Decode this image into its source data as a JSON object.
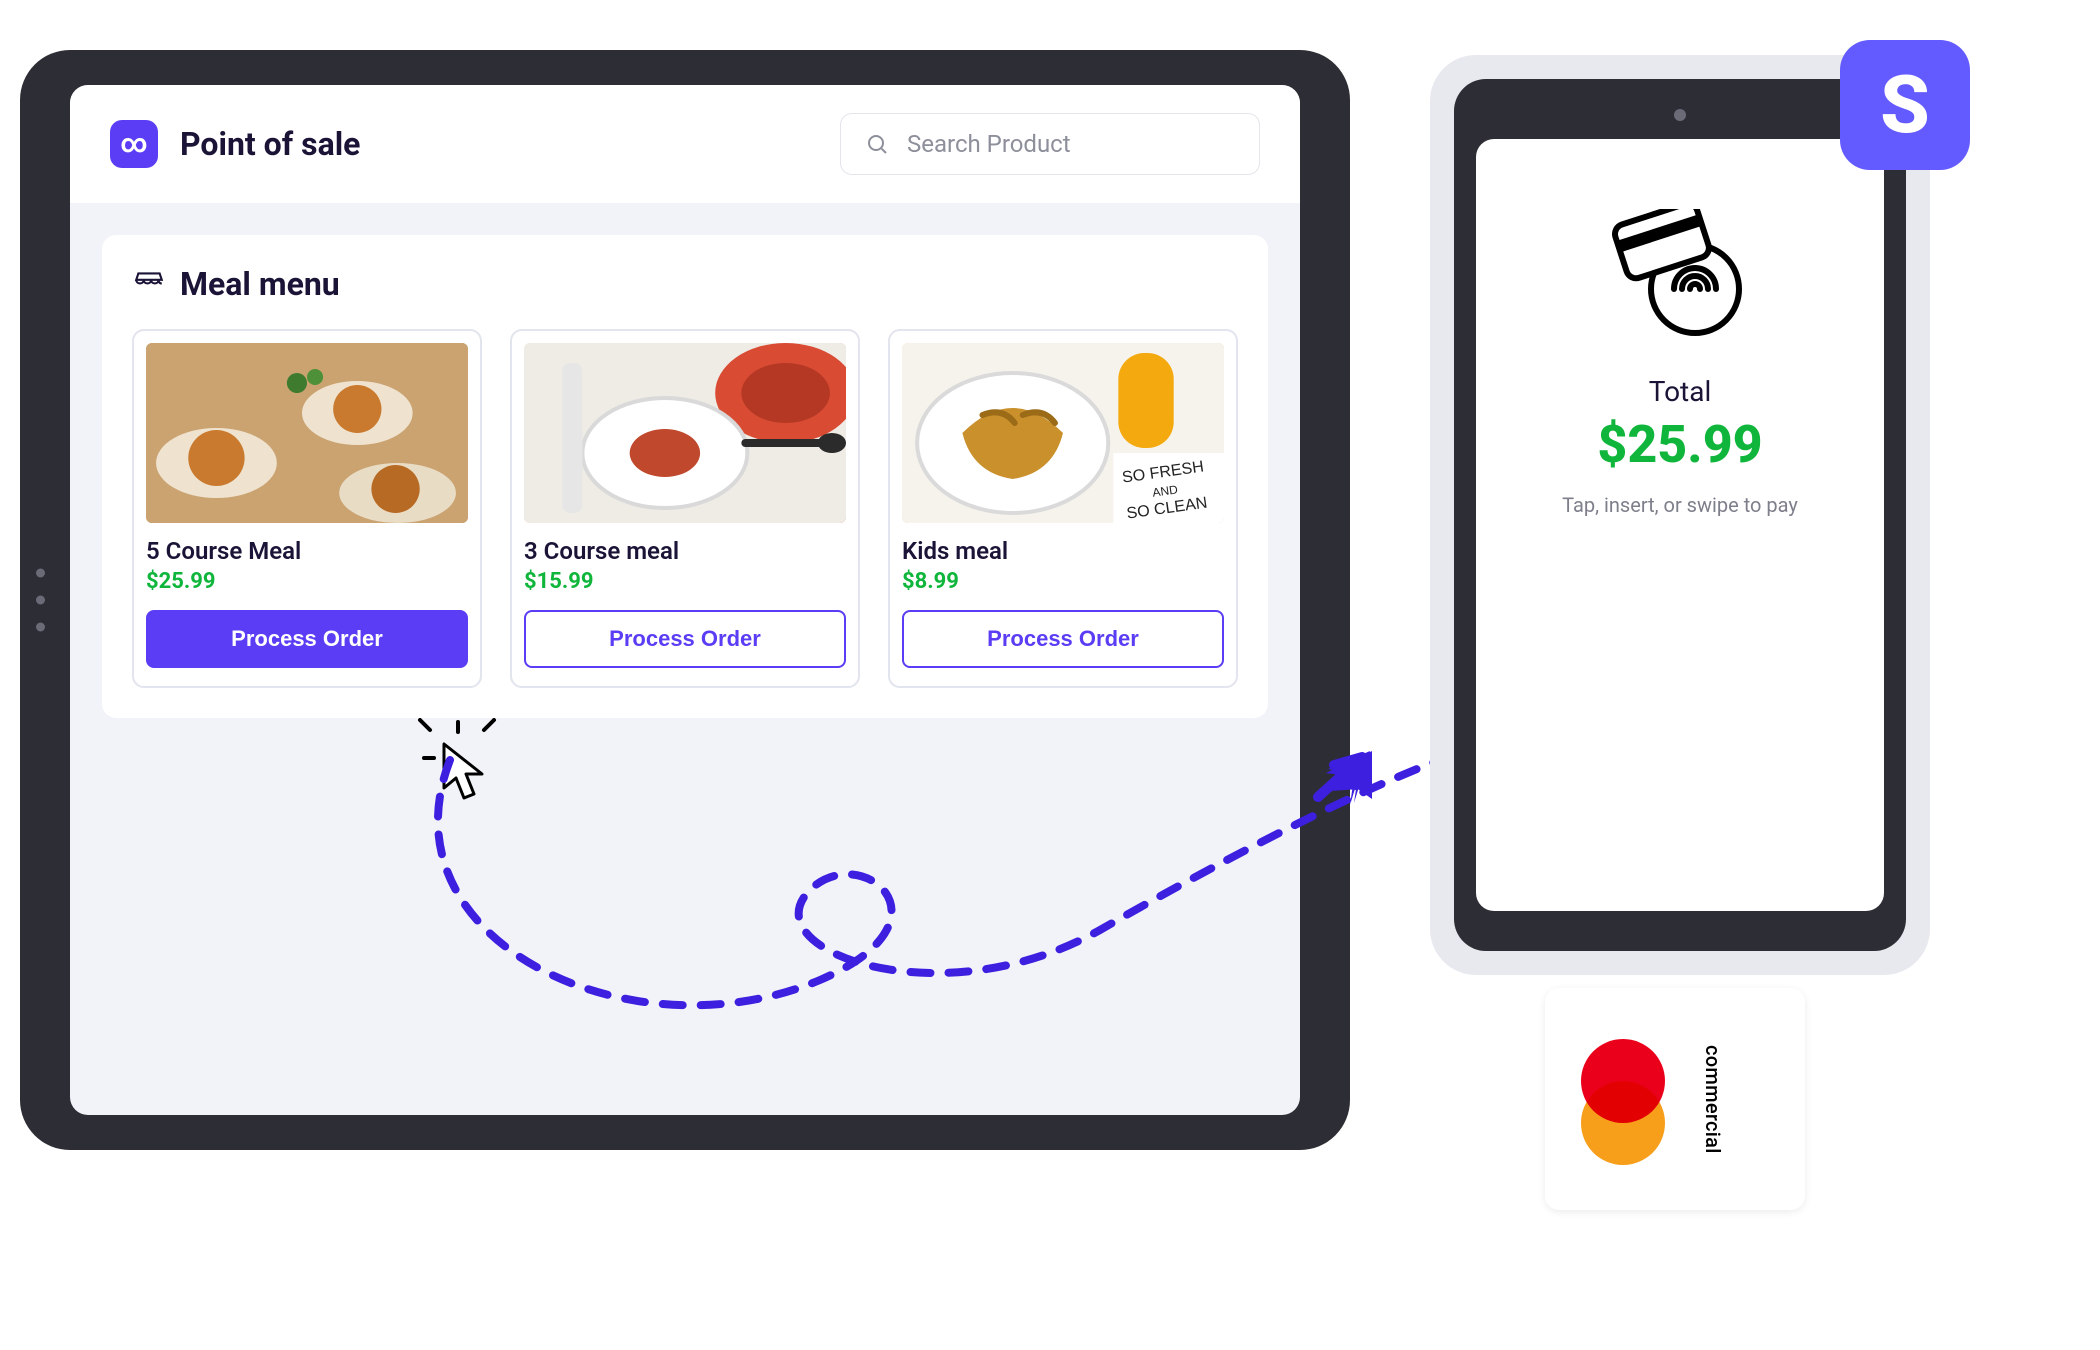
{
  "header": {
    "title": "Point of sale",
    "logo_glyph": "∞",
    "search_placeholder": "Search Product"
  },
  "section": {
    "title": "Meal menu"
  },
  "meals": [
    {
      "name": "5 Course Meal",
      "price": "$25.99",
      "button": "Process Order",
      "primary": true
    },
    {
      "name": "3 Course meal",
      "price": "$15.99",
      "button": "Process Order",
      "primary": false
    },
    {
      "name": "Kids meal",
      "price": "$8.99",
      "button": "Process Order",
      "primary": false
    }
  ],
  "terminal": {
    "total_label": "Total",
    "total_amount": "$25.99",
    "hint": "Tap, insert, or swipe to pay"
  },
  "stripe": {
    "glyph": "S"
  },
  "card": {
    "label": "commercial"
  }
}
